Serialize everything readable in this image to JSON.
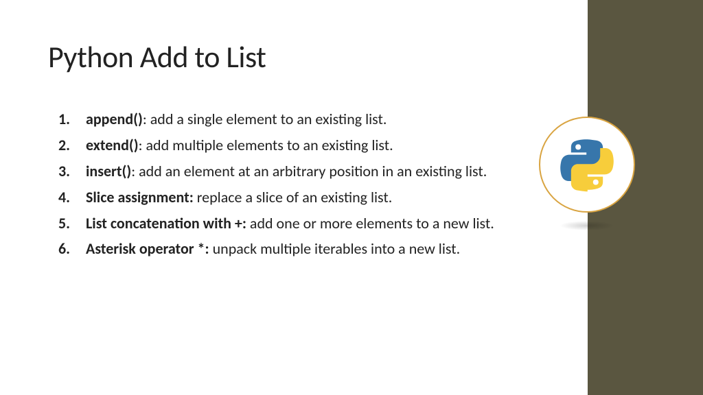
{
  "title": "Python Add to List",
  "items": [
    {
      "term": "append()",
      "sep": ": ",
      "desc": "add a single element to an existing list."
    },
    {
      "term": "extend()",
      "sep": ": ",
      "desc": "add multiple elements to an existing list."
    },
    {
      "term": "insert()",
      "sep": ": ",
      "desc": "add an element at an arbitrary position in an existing list."
    },
    {
      "term": "Slice assignment:",
      "sep": " ",
      "desc": "replace a slice of an existing list."
    },
    {
      "term": "List concatenation with +:",
      "sep": " ",
      "desc": "add one or more elements to a new list."
    },
    {
      "term": "Asterisk operator *:",
      "sep": " ",
      "desc": "unpack multiple iterables into a new list."
    }
  ],
  "logo_name": "python-logo",
  "colors": {
    "sidebar": "#5a5640",
    "badge_border": "#d9a441",
    "py_blue": "#3776ab",
    "py_yellow": "#f7cd3b"
  }
}
